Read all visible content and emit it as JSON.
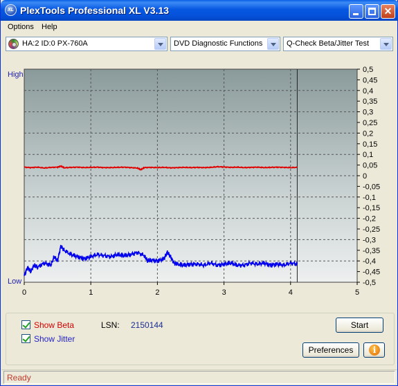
{
  "window": {
    "title": "PlexTools Professional XL V3.13",
    "logo": "XL"
  },
  "menu": {
    "items": [
      "Options",
      "Help"
    ]
  },
  "toolbar": {
    "drive": "HA:2 ID:0  PX-760A",
    "function": "DVD Diagnostic Functions",
    "test": "Q-Check Beta/Jitter Test"
  },
  "chart_data": {
    "type": "line",
    "title": "",
    "left_axis_labels": {
      "top": "High",
      "bottom": "Low"
    },
    "x_ticks": [
      "0",
      "1",
      "2",
      "3",
      "4",
      "5"
    ],
    "xlim": [
      0,
      5
    ],
    "y_right_ticks": [
      "0,5",
      "0,45",
      "0,4",
      "0,35",
      "0,3",
      "0,25",
      "0,2",
      "0,15",
      "0,1",
      "0,05",
      "0",
      "-0,05",
      "-0,1",
      "-0,15",
      "-0,2",
      "-0,25",
      "-0,3",
      "-0,35",
      "-0,4",
      "-0,45",
      "-0,5"
    ],
    "ylim": [
      -0.5,
      0.5
    ],
    "grid": true,
    "end_marker_x": 4.1,
    "series": [
      {
        "name": "Beta",
        "color": "#e00000",
        "x": [
          0,
          0.1,
          0.2,
          0.3,
          0.4,
          0.5,
          0.55,
          0.6,
          0.7,
          0.8,
          0.9,
          1.0,
          1.1,
          1.2,
          1.3,
          1.4,
          1.5,
          1.6,
          1.7,
          1.75,
          1.8,
          1.9,
          2.0,
          2.1,
          2.2,
          2.3,
          2.4,
          2.5,
          2.6,
          2.7,
          2.8,
          2.9,
          3.0,
          3.1,
          3.2,
          3.3,
          3.4,
          3.5,
          3.6,
          3.7,
          3.8,
          3.9,
          4.0,
          4.1
        ],
        "y": [
          0.04,
          0.038,
          0.04,
          0.036,
          0.039,
          0.04,
          0.045,
          0.037,
          0.039,
          0.04,
          0.038,
          0.039,
          0.04,
          0.038,
          0.038,
          0.039,
          0.04,
          0.038,
          0.036,
          0.028,
          0.038,
          0.039,
          0.038,
          0.039,
          0.037,
          0.038,
          0.039,
          0.038,
          0.039,
          0.038,
          0.039,
          0.042,
          0.041,
          0.039,
          0.04,
          0.038,
          0.039,
          0.04,
          0.038,
          0.039,
          0.04,
          0.039,
          0.038,
          0.039
        ]
      },
      {
        "name": "Jitter",
        "color": "#0000ee",
        "x": [
          0,
          0.05,
          0.1,
          0.15,
          0.2,
          0.3,
          0.4,
          0.45,
          0.5,
          0.55,
          0.6,
          0.7,
          0.8,
          0.9,
          1.0,
          1.1,
          1.2,
          1.3,
          1.4,
          1.5,
          1.6,
          1.7,
          1.8,
          1.85,
          1.9,
          2.0,
          2.1,
          2.15,
          2.2,
          2.25,
          2.3,
          2.4,
          2.5,
          2.6,
          2.7,
          2.8,
          2.9,
          3.0,
          3.1,
          3.2,
          3.3,
          3.4,
          3.5,
          3.6,
          3.7,
          3.8,
          3.9,
          4.0,
          4.1
        ],
        "y": [
          -0.47,
          -0.43,
          -0.45,
          -0.42,
          -0.43,
          -0.41,
          -0.42,
          -0.38,
          -0.4,
          -0.33,
          -0.35,
          -0.37,
          -0.38,
          -0.39,
          -0.38,
          -0.37,
          -0.375,
          -0.38,
          -0.37,
          -0.375,
          -0.37,
          -0.36,
          -0.375,
          -0.4,
          -0.395,
          -0.4,
          -0.39,
          -0.36,
          -0.38,
          -0.41,
          -0.415,
          -0.42,
          -0.415,
          -0.415,
          -0.42,
          -0.41,
          -0.42,
          -0.415,
          -0.41,
          -0.42,
          -0.42,
          -0.41,
          -0.415,
          -0.41,
          -0.42,
          -0.415,
          -0.42,
          -0.41,
          -0.415
        ]
      }
    ]
  },
  "options": {
    "show_beta": {
      "label": "Show Beta",
      "checked": true,
      "color": "#e00000"
    },
    "show_jitter": {
      "label": "Show Jitter",
      "checked": true,
      "color": "#0000ee"
    }
  },
  "lsn": {
    "label": "LSN:",
    "value": "2150144"
  },
  "buttons": {
    "start": "Start",
    "preferences": "Preferences",
    "info_icon": "i"
  },
  "status": {
    "text": "Ready"
  }
}
